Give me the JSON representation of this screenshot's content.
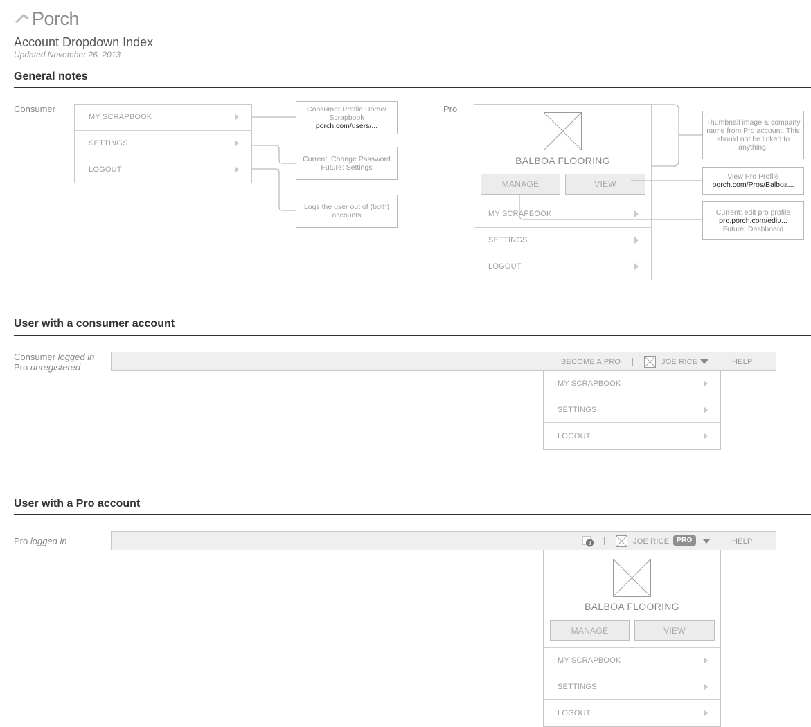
{
  "header": {
    "logo_text": "Porch",
    "title": "Account Dropdown Index",
    "updated": "Updated November 26, 2013"
  },
  "general": {
    "title": "General notes",
    "consumer_label": "Consumer",
    "pro_label": "Pro",
    "consumer_menu": [
      "MY SCRAPBOOK",
      "SETTINGS",
      "LOGOUT"
    ],
    "pro_card": {
      "company": "BALBOA FLOORING",
      "manage": "MANAGE",
      "view": "VIEW",
      "menu": [
        "MY SCRAPBOOK",
        "SETTINGS",
        "LOGOUT"
      ]
    },
    "notes": {
      "scrapbook_text": "Consumer Profile Home/ Scrapbook",
      "scrapbook_url": "porch.com/users/...",
      "settings_line1": "Current: Change Password",
      "settings_line2": "Future: Settings",
      "logout_text": "Logs the user out of (both) accounts",
      "thumb_text": "Thumbnail image & company name from Pro account. This should not be linked to anything.",
      "view_text": "View Pro Profile",
      "view_url": "porch.com/Pros/Balboa...",
      "manage_line1": "Current: edit pro profile",
      "manage_url": "pro.porch.com/edit/...",
      "manage_line3": "Future: Dashboard"
    }
  },
  "consumer_section": {
    "title": "User with a consumer account",
    "label_line1_a": "Consumer ",
    "label_line1_b": "logged in",
    "label_line2_a": "Pro ",
    "label_line2_b": "unregistered",
    "nav": {
      "become_pro": "BECOME A PRO",
      "user": "JOE RICE",
      "help": "HELP"
    },
    "menu": [
      "MY SCRAPBOOK",
      "SETTINGS",
      "LOGOUT"
    ]
  },
  "pro_section": {
    "title": "User with a Pro account",
    "label_a": "Pro ",
    "label_b": "logged in",
    "nav": {
      "message_count": "3",
      "user": "JOE RICE",
      "badge": "PRO",
      "help": "HELP"
    },
    "card": {
      "company": "BALBOA FLOORING",
      "manage": "MANAGE",
      "view": "VIEW",
      "menu": [
        "MY SCRAPBOOK",
        "SETTINGS",
        "LOGOUT"
      ]
    }
  }
}
